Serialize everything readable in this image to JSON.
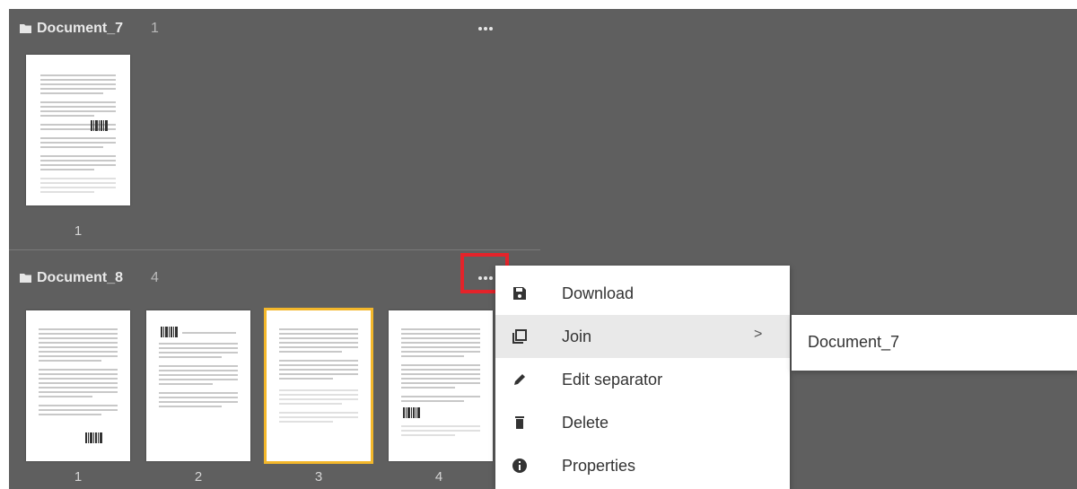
{
  "documents": [
    {
      "name": "Document_7",
      "count": "1",
      "pages": [
        "1"
      ],
      "more_icon": "more-horizontal-icon",
      "folder_icon": "folder-icon"
    },
    {
      "name": "Document_8",
      "count": "4",
      "pages": [
        "1",
        "2",
        "3",
        "4"
      ],
      "selected_page": "3",
      "more_icon": "more-horizontal-icon",
      "folder_icon": "folder-icon"
    }
  ],
  "context_menu": {
    "items": [
      {
        "label": "Download",
        "icon": "save-icon"
      },
      {
        "label": "Join",
        "icon": "copy-icon",
        "has_submenu": true,
        "chevron": ">"
      },
      {
        "label": "Edit separator",
        "icon": "pencil-icon"
      },
      {
        "label": "Delete",
        "icon": "trash-icon"
      },
      {
        "label": "Properties",
        "icon": "info-icon"
      }
    ],
    "submenu": {
      "items": [
        {
          "label": "Document_7"
        }
      ]
    }
  },
  "colors": {
    "panel_bg": "#5f5f5f",
    "selected_outline": "#f3b72b",
    "highlight_box": "#e4232a",
    "menu_active": "#e9e9e9"
  }
}
